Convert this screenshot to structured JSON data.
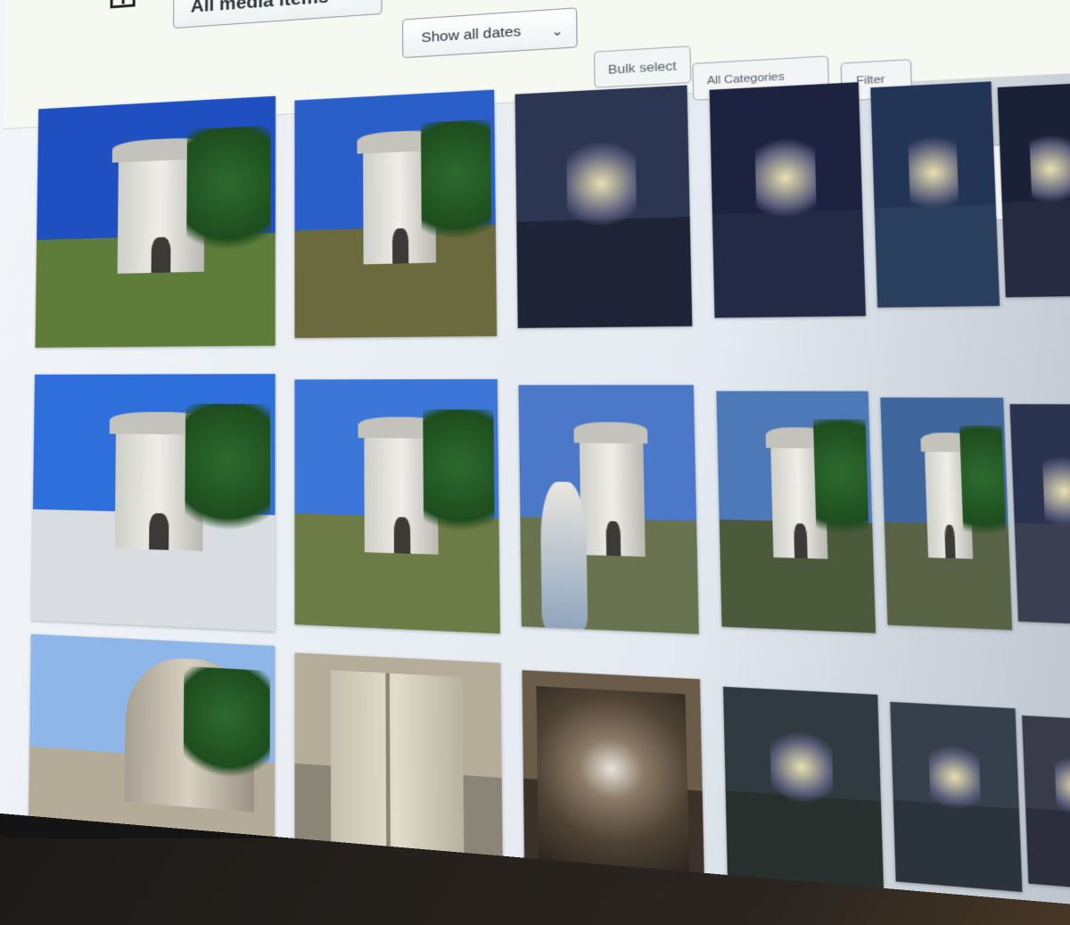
{
  "toolbar": {
    "media_filter": {
      "selected": "All media items"
    },
    "date_filter": {
      "selected": "Show all dates"
    },
    "bulk_select_label": "Bulk select",
    "category_filter": {
      "selected": "All Categories"
    },
    "filter_button_label": "Filter"
  },
  "gallery": {
    "items": [
      {
        "index": 0,
        "scene": "mausoleum",
        "sky": "#1f4fc0",
        "ground": "#5f7d3a"
      },
      {
        "index": 1,
        "scene": "mausoleum",
        "sky": "#2a5fc9",
        "ground": "#6b6a3e"
      },
      {
        "index": 2,
        "scene": "interior-dark",
        "sky": "#2c3552",
        "ground": "#1e2436"
      },
      {
        "index": 3,
        "scene": "interior-dark",
        "sky": "#1c2240",
        "ground": "#232a45"
      },
      {
        "index": 4,
        "scene": "interior-dark",
        "sky": "#223556",
        "ground": "#2a3e5d"
      },
      {
        "index": 5,
        "scene": "interior-dark",
        "sky": "#1a2035",
        "ground": "#252a3e"
      },
      {
        "index": 6,
        "scene": "interior-dark",
        "sky": "#1d2339",
        "ground": "#222a40"
      },
      {
        "index": 7,
        "scene": "interior-dark",
        "sky": "#20273c",
        "ground": "#262c40"
      },
      {
        "index": 8,
        "scene": "mausoleum",
        "sky": "#2e6fdc",
        "ground": "#d9dde2"
      },
      {
        "index": 9,
        "scene": "mausoleum",
        "sky": "#3b76d8",
        "ground": "#6d7b46"
      },
      {
        "index": 10,
        "scene": "visitor",
        "sky": "#4b78c8",
        "ground": "#6a7350"
      },
      {
        "index": 11,
        "scene": "mausoleum",
        "sky": "#4d79b8",
        "ground": "#4a5a3a"
      },
      {
        "index": 12,
        "scene": "mausoleum",
        "sky": "#40669e",
        "ground": "#5a6346"
      },
      {
        "index": 13,
        "scene": "interior-dark",
        "sky": "#2a3350",
        "ground": "#3b3f52"
      },
      {
        "index": 14,
        "scene": "interior-dark",
        "sky": "#2e3148",
        "ground": "#3a3c4f"
      },
      {
        "index": 15,
        "scene": "interior-dark",
        "sky": "#2f5a86",
        "ground": "#35405a"
      },
      {
        "index": 16,
        "scene": "church",
        "sky": "#8fb6e8",
        "ground": "#b4ab98"
      },
      {
        "index": 17,
        "scene": "door",
        "sky": "#b5ad99",
        "ground": "#8a8576"
      },
      {
        "index": 18,
        "scene": "vault",
        "sky": "#6b5c4a",
        "ground": "#3b3229"
      },
      {
        "index": 19,
        "scene": "interior-dark",
        "sky": "#2f3b40",
        "ground": "#28302e"
      },
      {
        "index": 20,
        "scene": "interior-dark",
        "sky": "#36404c",
        "ground": "#2b333d"
      },
      {
        "index": 21,
        "scene": "interior-dark",
        "sky": "#3a3b4a",
        "ground": "#2c2e3b"
      },
      {
        "index": 22,
        "scene": "interior-dark",
        "sky": "#2b3145",
        "ground": "#252a3a"
      },
      {
        "index": 23,
        "scene": "interior-dark",
        "sky": "#2c3248",
        "ground": "#262b3c"
      }
    ]
  }
}
